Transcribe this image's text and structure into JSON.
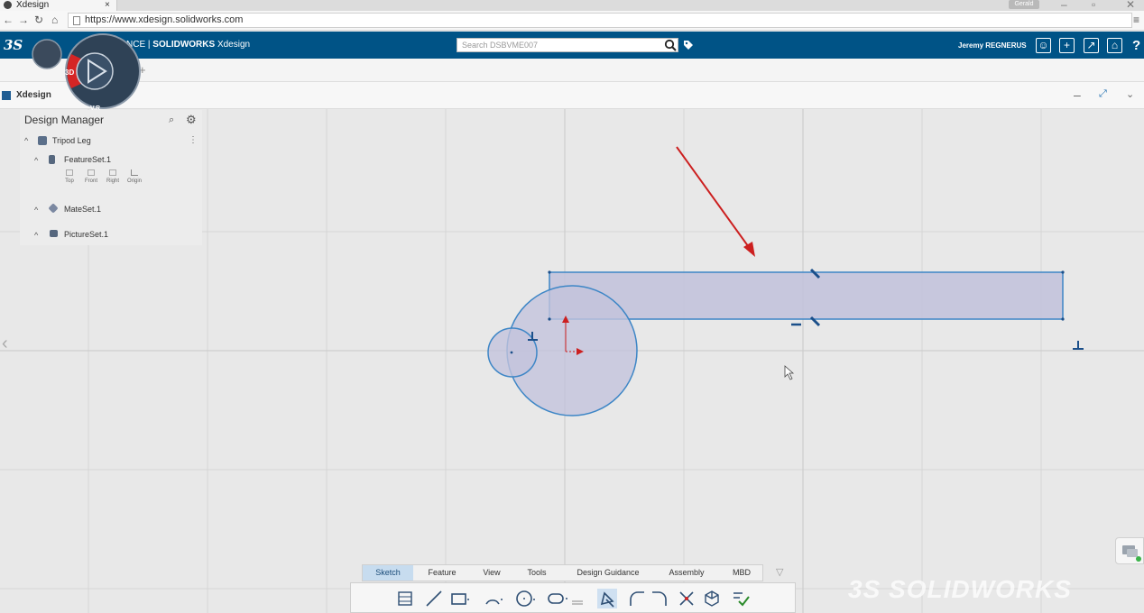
{
  "browser": {
    "tab_title": "Xdesign",
    "tab_close": "×",
    "window_user": "Gerald",
    "url": "https://www.xdesign.solidworks.com"
  },
  "header": {
    "logo": "3S",
    "brand_prefix": "NCE | ",
    "brand_name": "SOLIDWORKS",
    "brand_suffix": " Xdesign",
    "search_placeholder": "Search DSBVME007",
    "username": "Jeremy REGNERUS",
    "help": "?"
  },
  "app": {
    "name": "Xdesign",
    "compass_label": "V.R",
    "compass_3d": "3D"
  },
  "design_manager": {
    "title": "Design Manager",
    "root": "Tripod Leg",
    "featureset": "FeatureSet.1",
    "planes": [
      "Top",
      "Front",
      "Right",
      "Origin"
    ],
    "mateset": "MateSet.1",
    "pictureset": "PictureSet.1"
  },
  "bottom_tabs": [
    {
      "label": "Sketch",
      "active": true
    },
    {
      "label": "Feature",
      "active": false
    },
    {
      "label": "View",
      "active": false
    },
    {
      "label": "Tools",
      "active": false
    },
    {
      "label": "Design Guidance",
      "active": false
    },
    {
      "label": "Assembly",
      "active": false
    },
    {
      "label": "MBD",
      "active": false
    }
  ],
  "watermark": "3S SOLIDWORKS",
  "colors": {
    "header_blue": "#005386",
    "sketch_fill": "#c3c3dc",
    "sketch_stroke": "#3d86c6",
    "annotation_arrow": "#cc1f1f",
    "constraint": "#1b4f8a"
  }
}
